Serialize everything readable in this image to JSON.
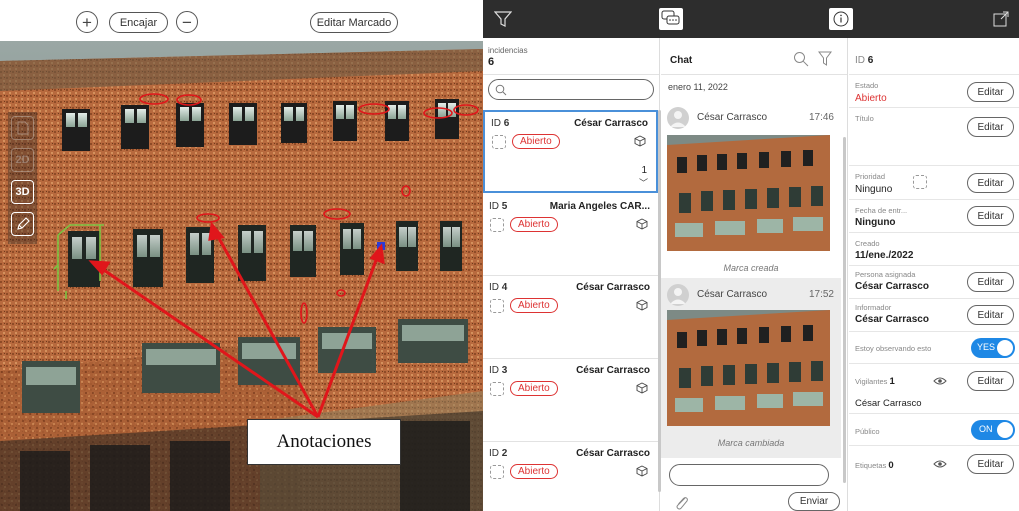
{
  "viewer": {
    "toolbar": {
      "zoom_in_symbol": "+",
      "fit_label": "Encajar",
      "zoom_out_symbol": "−",
      "edit_markup_label": "Editar Marcado"
    },
    "rail": {
      "btn_2d_label": "2D",
      "btn_3d_label": "3D"
    },
    "annotation_callout": "Anotaciones"
  },
  "list": {
    "header_label": "incidencias",
    "count": "6",
    "issues": [
      {
        "id_prefix": "ID",
        "id": "6",
        "assignee": "César Carrasco",
        "status": "Abierto",
        "comments": "1",
        "chevron": "﹀"
      },
      {
        "id_prefix": "ID",
        "id": "5",
        "assignee": "Maria Angeles CAR...",
        "status": "Abierto"
      },
      {
        "id_prefix": "ID",
        "id": "4",
        "assignee": "César Carrasco",
        "status": "Abierto"
      },
      {
        "id_prefix": "ID",
        "id": "3",
        "assignee": "César Carrasco",
        "status": "Abierto"
      },
      {
        "id_prefix": "ID",
        "id": "2",
        "assignee": "César Carrasco",
        "status": "Abierto"
      }
    ]
  },
  "chat": {
    "title": "Chat",
    "date": "enero 11, 2022",
    "messages": [
      {
        "author": "César Carrasco",
        "time": "17:46",
        "caption": "Marca creada"
      },
      {
        "author": "César Carrasco",
        "time": "17:52",
        "caption": "Marca cambiada"
      }
    ],
    "send_label": "Enviar"
  },
  "detail": {
    "id_prefix": "ID",
    "id": "6",
    "edit_label": "Editar",
    "estado_label": "Estado",
    "estado_value": "Abierto",
    "titulo_label": "Título",
    "prioridad_label": "Prioridad",
    "prioridad_value": "Ninguno",
    "fecha_label": "Fecha de entr...",
    "fecha_value": "Ninguno",
    "creado_label": "Creado",
    "creado_value": "11/ene./2022",
    "persona_label": "Persona asignada",
    "persona_value": "César Carrasco",
    "informador_label": "Informador",
    "informador_value": "César Carrasco",
    "observando_label": "Estoy observando esto",
    "observando_toggle": "YES",
    "vigilantes_label": "Vigilantes",
    "vigilantes_count": "1",
    "vigilante_name": "César Carrasco",
    "publico_label": "Público",
    "publico_toggle": "ON",
    "etiquetas_label": "Etiquetas",
    "etiquetas_count": "0"
  },
  "colors": {
    "topbar": "#2d2d2d",
    "status_red": "#d33333",
    "toggle_blue": "#1e88e5",
    "selection_blue": "#4a90d9",
    "annotation_red": "#e0161b",
    "annotation_green": "#7cc242",
    "annotation_blue": "#2a3bd8"
  }
}
